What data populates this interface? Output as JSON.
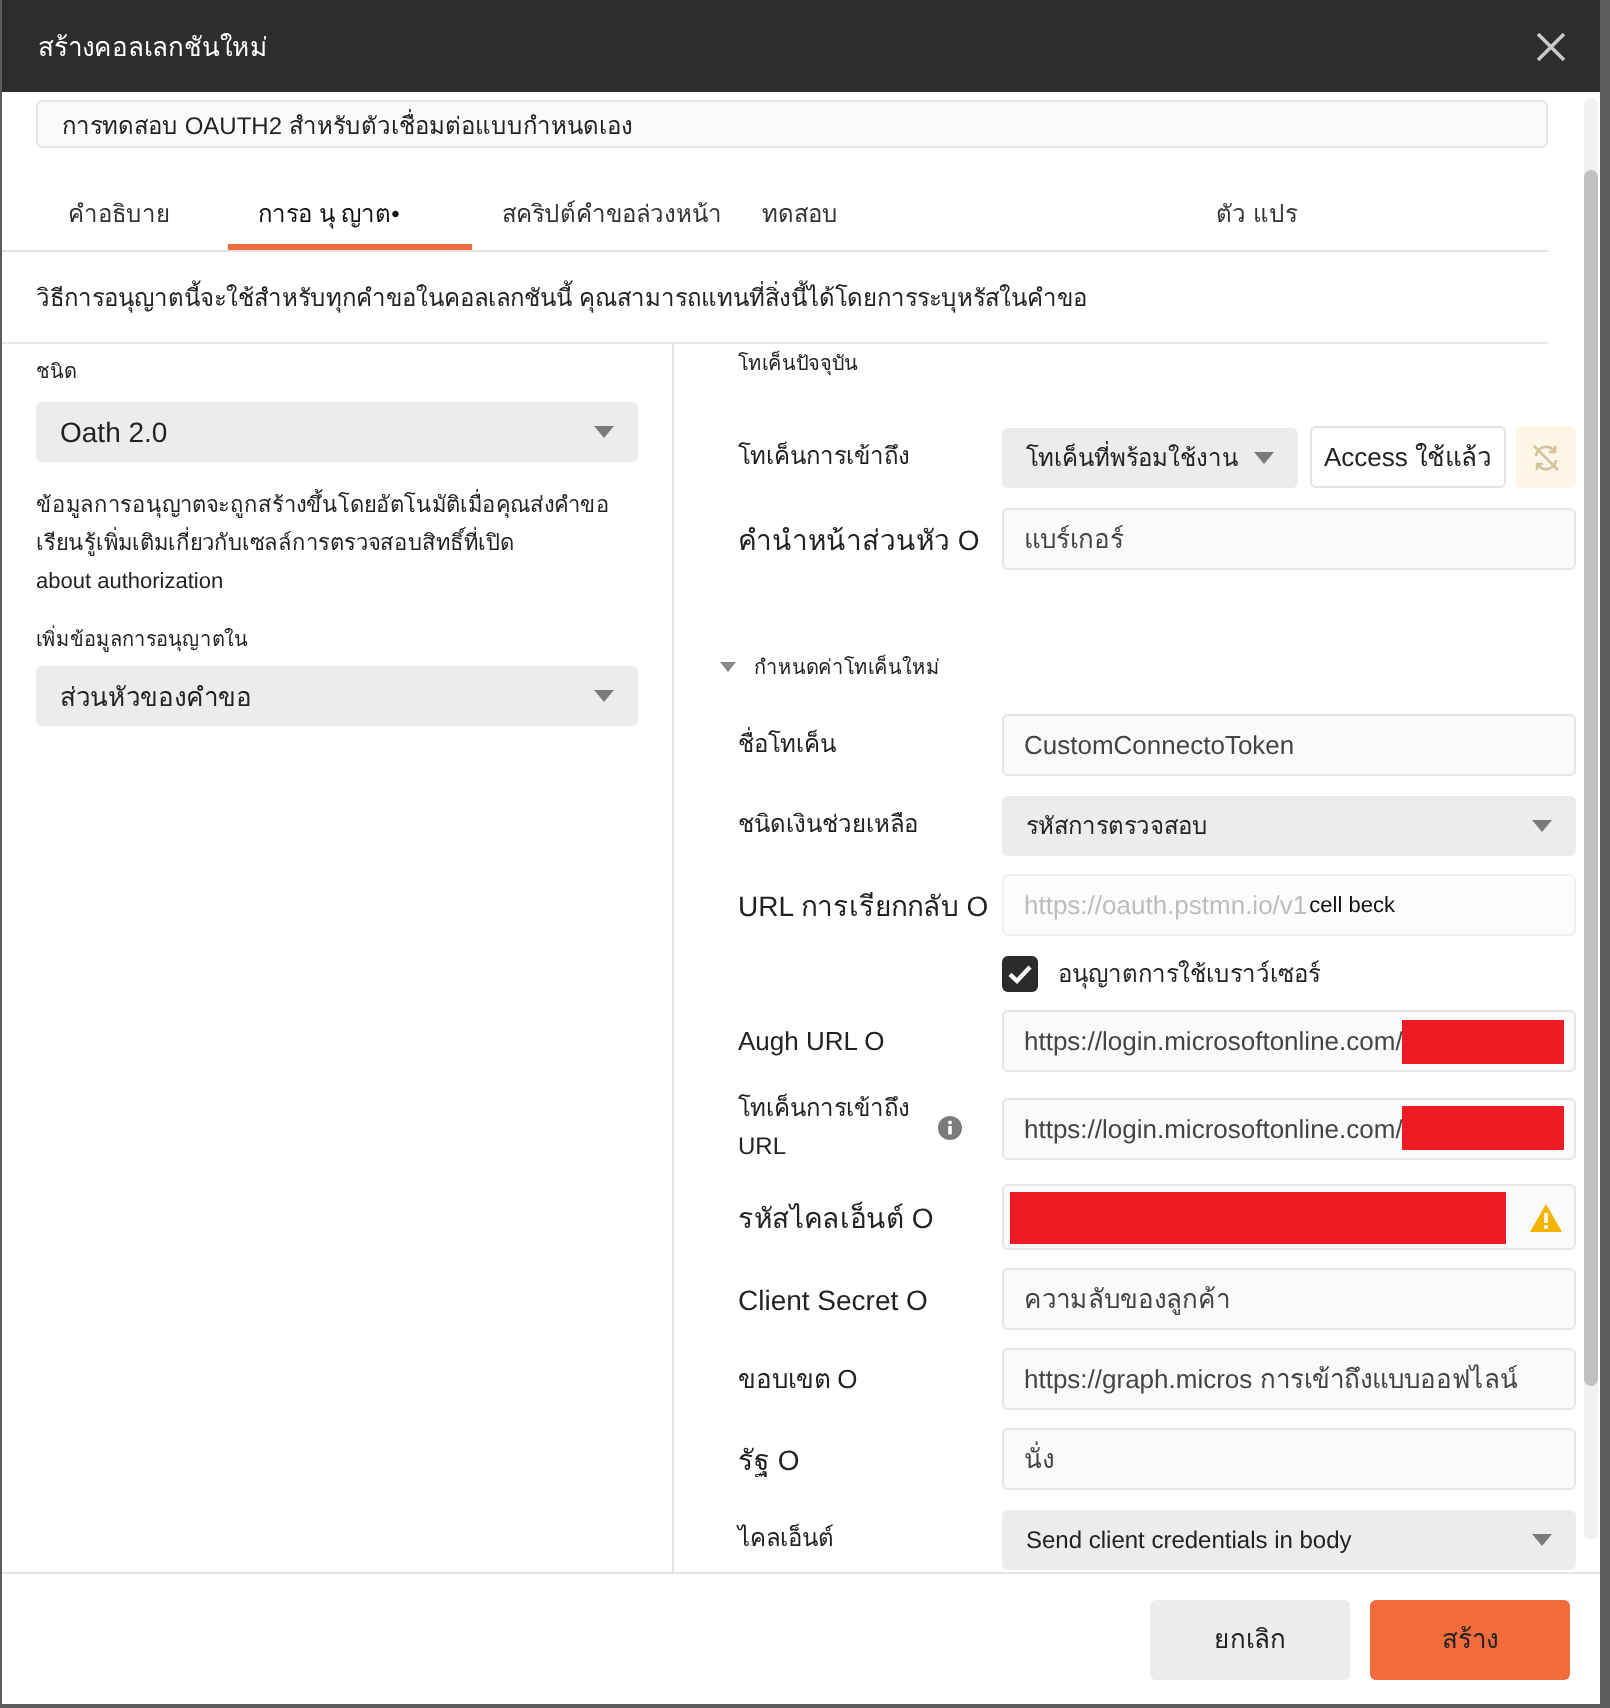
{
  "dialog": {
    "title": "สร้างคอลเลกชันใหม่"
  },
  "collection_name": {
    "value": "การทดสอบ OAUTH2 สำหรับตัวเชื่อมต่อแบบกำหนดเอง"
  },
  "tabs": [
    {
      "label": "คำอธิบาย",
      "selected": false
    },
    {
      "label": "การอ นุ ญาต•",
      "selected": true
    },
    {
      "label": "สคริปต์คำขอล่วงหน้า",
      "selected": false
    },
    {
      "label": "ทดสอบ",
      "selected": false
    },
    {
      "label": "ตัว แปร",
      "selected": false
    }
  ],
  "description": "วิธีการอนุญาตนี้จะใช้สำหรับทุกคำขอในคอลเลกชันนี้ คุณสามารถแทนที่สิ่งนี้ได้โดยการระบุหรัสในคำขอ",
  "auth_type": {
    "label": "ชนิด",
    "value": "Oath 2.0"
  },
  "info_lines": [
    "ข้อมูลการอนุญาตจะถูกสร้างขึ้นโดยอัตโนมัติเมื่อคุณส่งคำขอ",
    "เรียนรู้เพิ่มเติมเกี่ยวกับเซลล์การตรวจสอบสิทธิ์ที่เปิด",
    "about authorization"
  ],
  "add_auth_to": {
    "label": "เพิ่มข้อมูลการอนุญาตใน",
    "value": "ส่วนหัวของคำขอ"
  },
  "current_token": {
    "heading": "โทเค็นปัจจุบัน",
    "fields": [
      {
        "kind": "token",
        "label": "โทเค็นการเข้าถึง",
        "value": "โทเค็นที่พร้อมใช้งาน",
        "button": "Access ใช้แล้ว"
      },
      {
        "kind": "input",
        "label": "คำนำหน้าส่วนหัว O",
        "value": "แบร์เกอร์"
      }
    ]
  },
  "new_token": {
    "heading": "กำหนดค่าโทเค็นใหม่",
    "expanded": true,
    "fields": [
      {
        "kind": "input",
        "label": "ชื่อโทเค็น",
        "value": "CustomConnectoToken"
      },
      {
        "kind": "select",
        "label": "ชนิดเงินช่วยเหลือ",
        "value": "รหัสการตรวจสอบ"
      },
      {
        "kind": "input",
        "label": "URL การเรียกกลับ O",
        "value": "https://oauth.pstmn.io/v1",
        "suffix": "cell beck",
        "disabled": true
      },
      {
        "kind": "checkbox",
        "label": "อนุญาตการใช้เบราว์เซอร์",
        "checked": true
      },
      {
        "kind": "input",
        "label": "Augh URL O",
        "value": "https://login.microsoftonline.com/",
        "redacted": true
      },
      {
        "kind": "input",
        "label_lines": [
          "โทเค็นการเข้าถึง",
          "URL"
        ],
        "info": true,
        "value": "https://login.microsoftonline.com/",
        "redacted": true
      },
      {
        "kind": "input",
        "label": "รหัสไคลเอ็นต์ O",
        "redacted": true,
        "warning": true
      },
      {
        "kind": "input",
        "label": "Client Secret O",
        "value": "ความลับของลูกค้า"
      },
      {
        "kind": "input",
        "label": "ขอบเขต O",
        "value": "https://graph.micros การเข้าถึงแบบออฟไลน์"
      },
      {
        "kind": "input",
        "label": "รัฐ O",
        "value": "นั่ง"
      },
      {
        "kind": "select",
        "label": "ไคลเอ็นต์",
        "value": "Send client credentials in body"
      }
    ]
  },
  "buttons": [
    {
      "label": "ยกเลิก",
      "kind": "secondary"
    },
    {
      "label": "สร้าง",
      "kind": "primary"
    }
  ]
}
